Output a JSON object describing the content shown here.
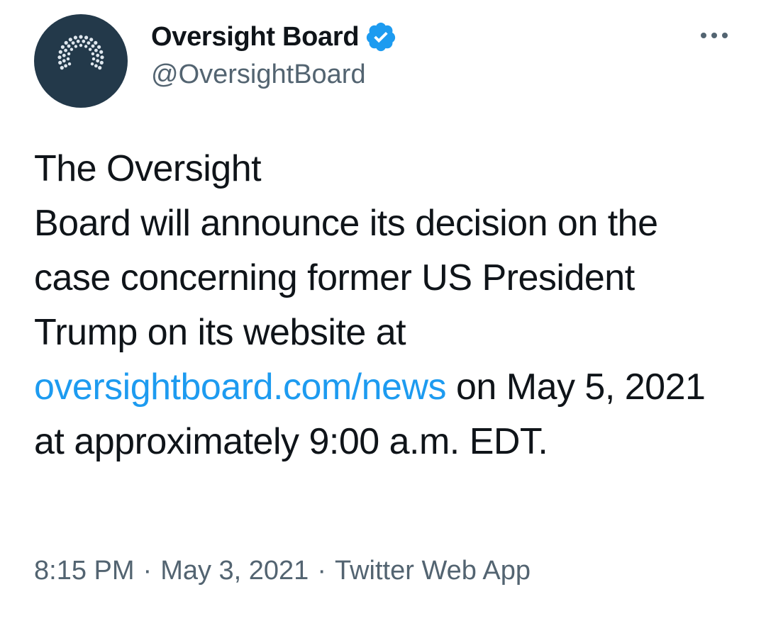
{
  "author": {
    "display_name": "Oversight Board",
    "handle": "@OversightBoard",
    "verified_icon": "verified-badge-icon",
    "avatar_icon": "oversight-board-logo",
    "avatar_bg": "#23394a"
  },
  "tweet": {
    "text_line1": "The Oversight",
    "text_line2_part1": "Board will announce its decision on the case concerning former US President Trump on its website at ",
    "link_text": "oversightboard.com/news",
    "text_after_link": " on May 5, 2021 at approximately 9:00 a.m. EDT."
  },
  "meta": {
    "time": "8:15 PM",
    "separator": "·",
    "date": "May 3, 2021",
    "source": "Twitter Web App"
  },
  "more_icon": "more-options-icon",
  "colors": {
    "link": "#1d9bf0",
    "secondary_text": "#536471",
    "primary_text": "#0f1419",
    "verified": "#1d9bf0"
  }
}
